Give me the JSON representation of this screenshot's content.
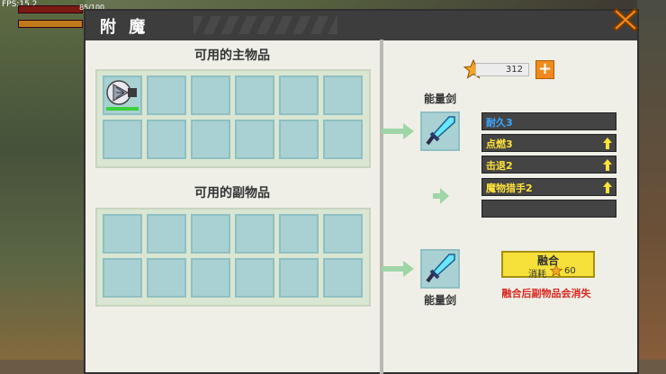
{
  "hud": {
    "fps": "FPS:15.2",
    "hp_text": "85/100"
  },
  "dialog": {
    "title": "附 魔"
  },
  "main_panel": {
    "title": "可用的主物品"
  },
  "sub_panel": {
    "title": "可用的副物品"
  },
  "main_grid": {
    "filled_slot": 0,
    "durability_fraction": 1.0
  },
  "currency": {
    "amount": "312",
    "plus": "+"
  },
  "result": {
    "top_label": "能量剑",
    "bottom_label": "能量剑"
  },
  "enchants": [
    {
      "label": "耐久3",
      "color": "#3aa8ff",
      "upgradable": false
    },
    {
      "label": "点燃3",
      "color": "#ffe23a",
      "upgradable": true
    },
    {
      "label": "击退2",
      "color": "#ffe23a",
      "upgradable": true
    },
    {
      "label": "魔物猎手2",
      "color": "#ffe23a",
      "upgradable": true
    },
    {
      "label": "",
      "color": "#ffe23a",
      "upgradable": false
    }
  ],
  "fuse": {
    "label": "融合",
    "cost_label": "消耗",
    "cost": "60"
  },
  "warning": "融合后副物品会消失",
  "colors": {
    "accent": "#f08a1d",
    "slot": "#a9d1d3",
    "warn": "#d8261d"
  }
}
